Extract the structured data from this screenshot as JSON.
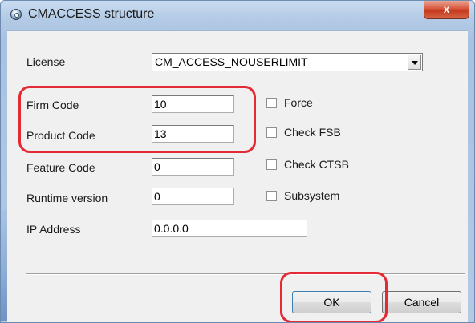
{
  "window": {
    "title": "CMACCESS structure",
    "close_label": "x",
    "icon": "app-icon"
  },
  "form": {
    "license": {
      "label": "License",
      "value": "CM_ACCESS_NOUSERLIMIT"
    },
    "firm_code": {
      "label": "Firm Code",
      "value": "10"
    },
    "product_code": {
      "label": "Product Code",
      "value": "13"
    },
    "feature_code": {
      "label": "Feature Code",
      "value": "0"
    },
    "runtime_version": {
      "label": "Runtime version",
      "value": "0"
    },
    "ip_address": {
      "label": "IP Address",
      "value": "0.0.0.0"
    }
  },
  "options": [
    {
      "label": "Force",
      "checked": false
    },
    {
      "label": "Check FSB",
      "checked": false
    },
    {
      "label": "Check CTSB",
      "checked": false
    },
    {
      "label": "Subsystem",
      "checked": false
    }
  ],
  "buttons": {
    "ok": "OK",
    "cancel": "Cancel"
  },
  "colors": {
    "highlight": "#e32a35",
    "close_button": "#d7553c",
    "titlebar": "#b4cbe6",
    "dialog_face": "#f0f0f0"
  }
}
